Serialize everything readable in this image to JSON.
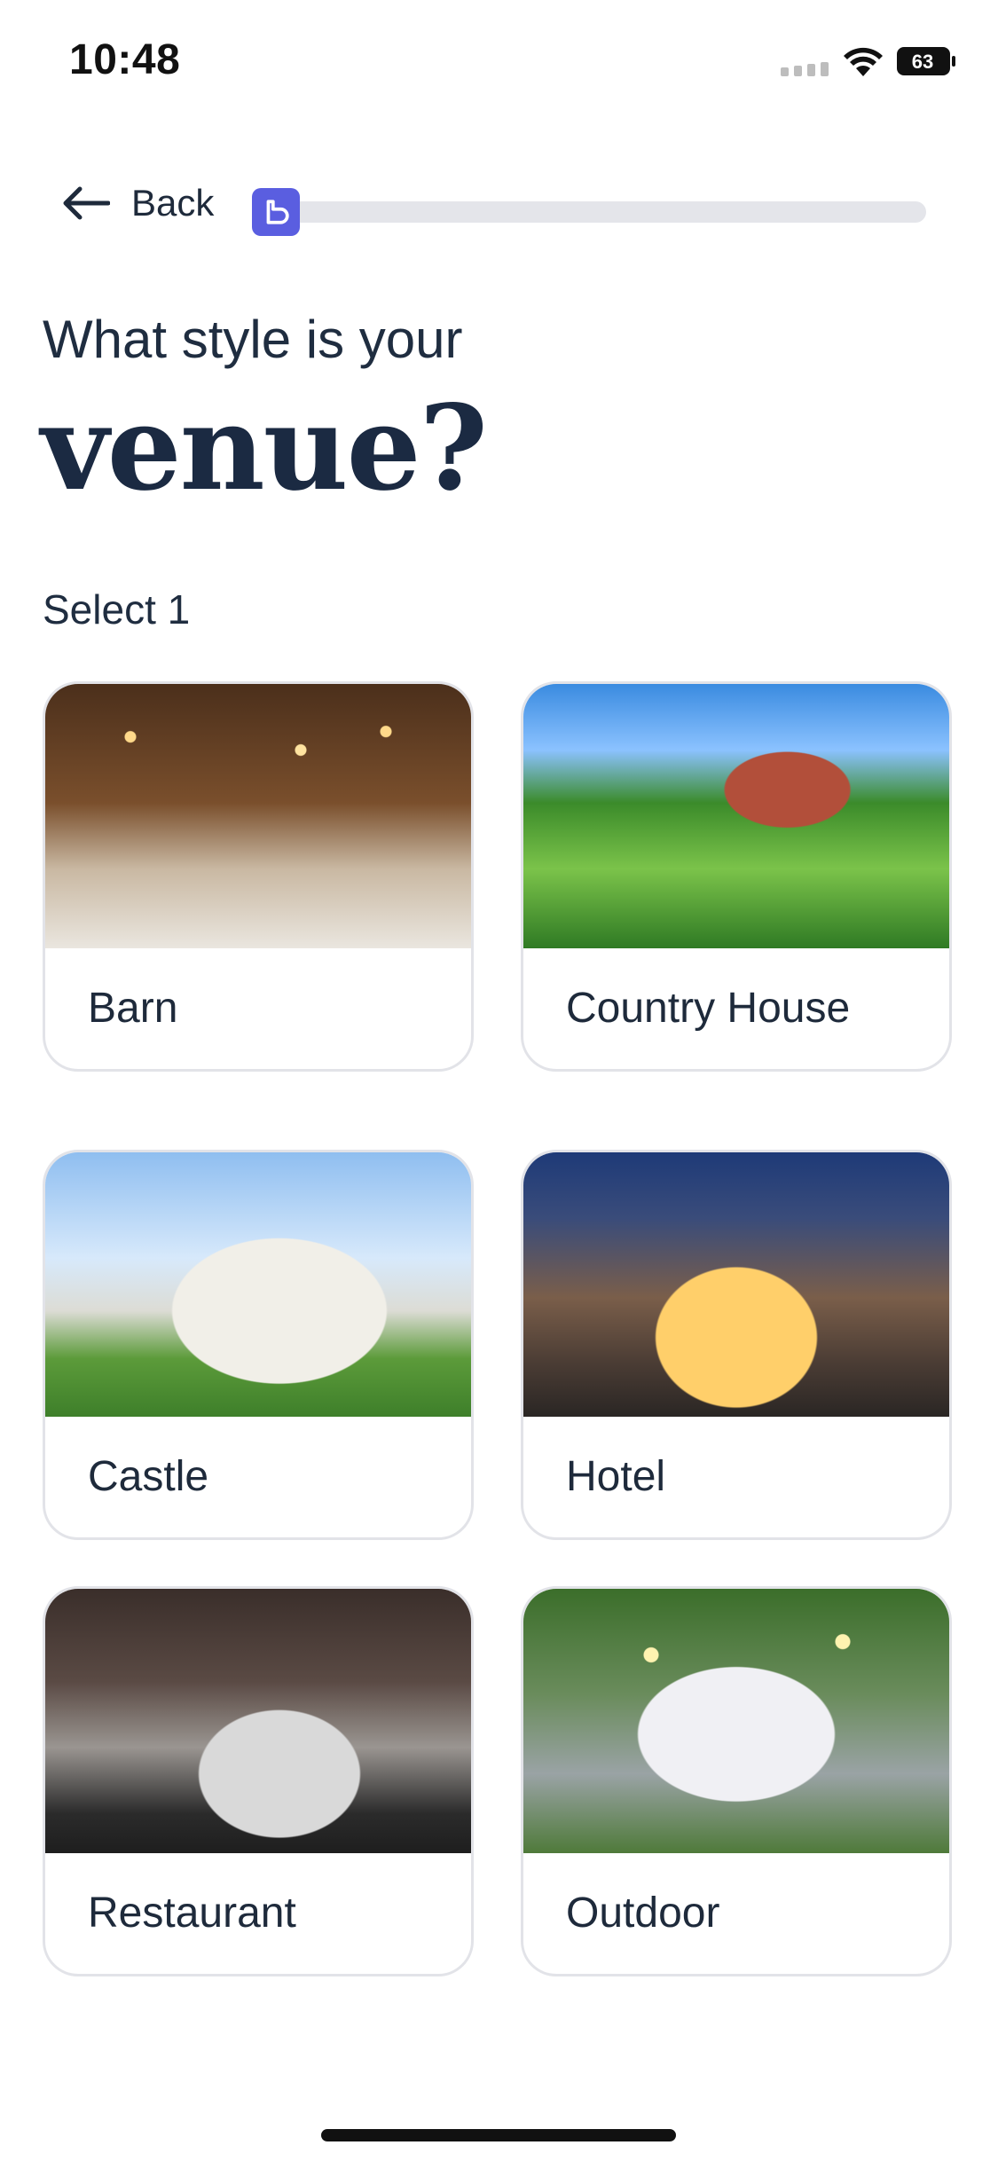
{
  "status": {
    "time": "10:48",
    "battery": "63"
  },
  "header": {
    "back_label": "Back",
    "progress": 0.05
  },
  "question": {
    "subtitle": "What style is your",
    "title": "venue?",
    "hint": "Select 1"
  },
  "options": [
    {
      "label": "Barn",
      "image": "barn-photo"
    },
    {
      "label": "Country House",
      "image": "country-house-photo"
    },
    {
      "label": "Castle",
      "image": "castle-photo"
    },
    {
      "label": "Hotel",
      "image": "hotel-photo"
    },
    {
      "label": "Restaurant",
      "image": "restaurant-photo"
    },
    {
      "label": "Outdoor",
      "image": "outdoor-photo"
    }
  ],
  "colors": {
    "accent": "#5a5ee0",
    "text": "#1e2a3b",
    "border": "#e2e3e8"
  }
}
